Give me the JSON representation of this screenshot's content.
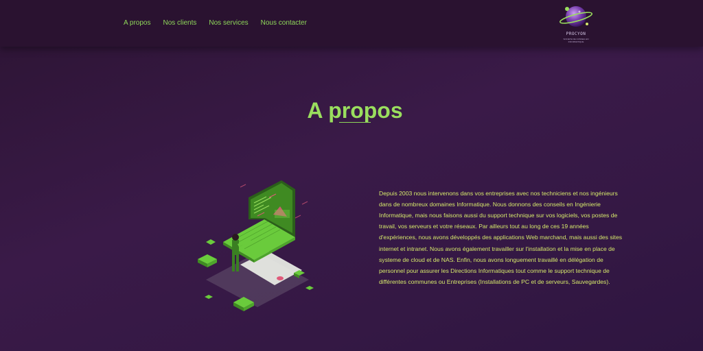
{
  "nav": {
    "items": [
      "A propos",
      "Nos clients",
      "Nos services",
      "Nous contacter"
    ]
  },
  "logo": {
    "name": "PROCYON",
    "tagline": "SOCIETE DE CONSEIL EN INFORMATIQUE"
  },
  "section": {
    "title": "A propos",
    "body": "Depuis 2003 nous intervenons dans vos entreprises avec nos techniciens et nos ingénieurs dans de nombreux domaines Informatique. Nous donnons des conseils en Ingénierie Informatique, mais nous faisons aussi du support technique sur vos logiciels, vos postes de travail, vos serveurs et votre réseaux. Par ailleurs tout au long de ces 19 années d'expériences, nous avons développés des applications Web marchand, mais aussi des sites internet et intranet. Nous avons également travailler sur l'installation et la mise en place de systeme de cloud et de NAS. Enfin, nous avons longuement travaillé en délégation de personnel pour assurer les Directions Informatiques tout comme le support technique de différentes communes ou Entreprises (Installations de PC et de serveurs, Sauvegardes)."
  },
  "colors": {
    "accent": "#9ade5e",
    "text": "#d6e96b",
    "background": "#3a1a48",
    "header": "#2a1230"
  }
}
